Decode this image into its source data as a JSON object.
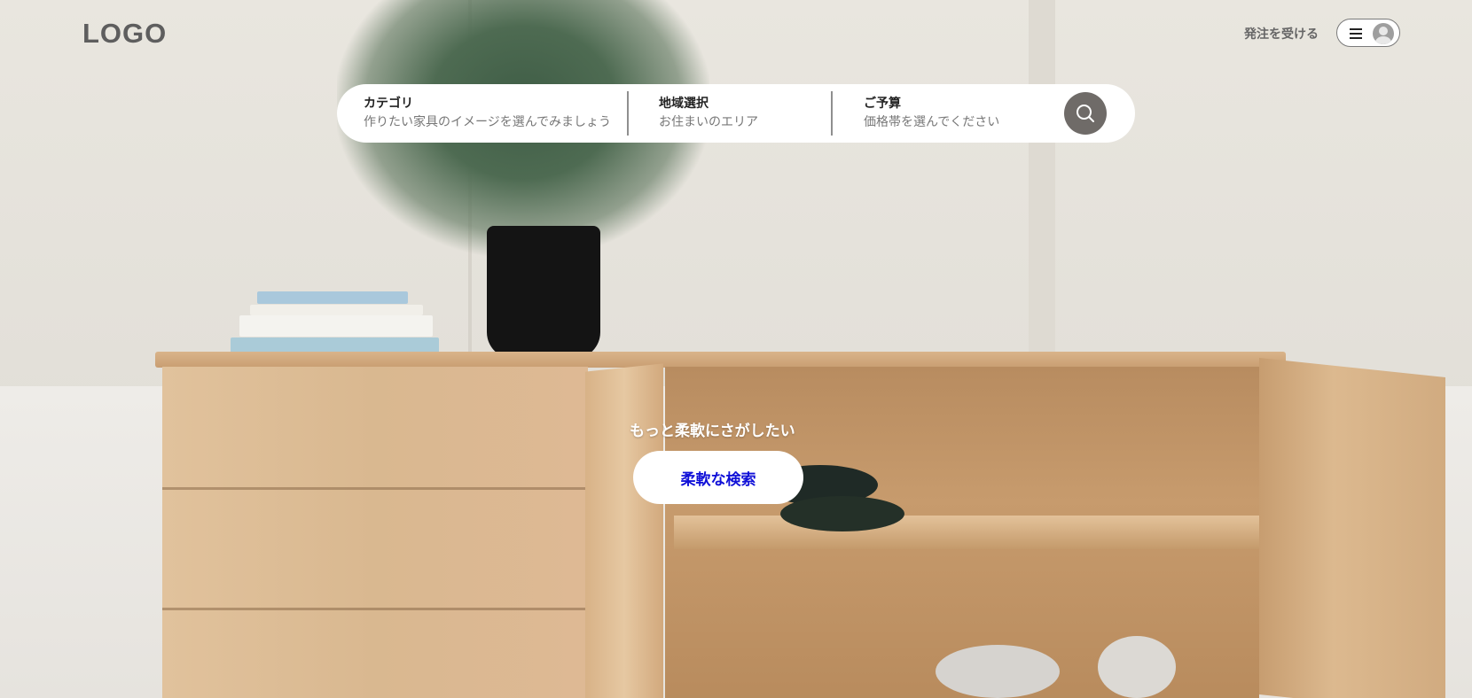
{
  "header": {
    "logo": "LOGO",
    "order_link": "発注を受ける",
    "menu_icon": "hamburger-menu-icon",
    "avatar_icon": "user-avatar-icon"
  },
  "search": {
    "category": {
      "label": "カテゴリ",
      "placeholder": "作りたい家具のイメージを選んでみましょう"
    },
    "region": {
      "label": "地域選択",
      "placeholder": "お住まいのエリア"
    },
    "budget": {
      "label": "ご予算",
      "placeholder": "価格帯を選んでください"
    },
    "button_icon": "search-icon"
  },
  "cta": {
    "title": "もっと柔軟にさがしたい",
    "button_label": "柔軟な検索"
  },
  "colors": {
    "search_button": "#6f6b68",
    "cta_text": "#1010d8",
    "logo": "#5e5e5e"
  }
}
